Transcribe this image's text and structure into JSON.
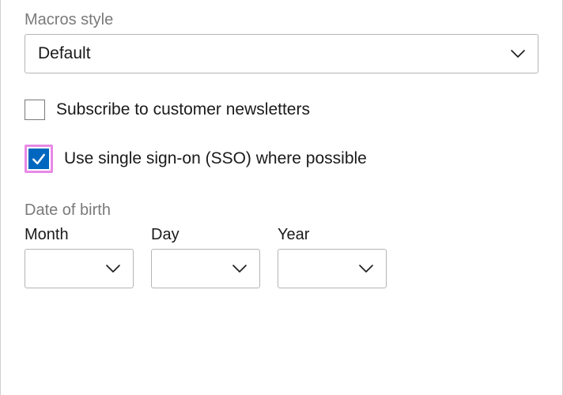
{
  "macros": {
    "label": "Macros style",
    "value": "Default"
  },
  "subscribe": {
    "checked": false,
    "label": "Subscribe to customer newsletters"
  },
  "sso": {
    "checked": true,
    "label": "Use single sign-on (SSO) where possible"
  },
  "dob": {
    "label": "Date of birth",
    "month": {
      "label": "Month",
      "value": ""
    },
    "day": {
      "label": "Day",
      "value": ""
    },
    "year": {
      "label": "Year",
      "value": ""
    }
  }
}
